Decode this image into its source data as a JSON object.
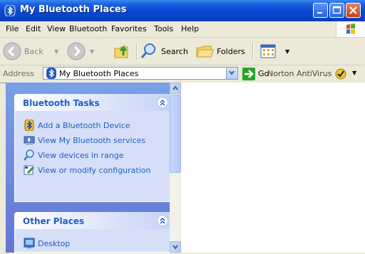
{
  "window": {
    "title": "My Bluetooth Places"
  },
  "menu": {
    "items": [
      "File",
      "Edit",
      "View",
      "Bluetooth",
      "Favorites",
      "Tools",
      "Help"
    ]
  },
  "toolbar": {
    "back": "Back",
    "search": "Search",
    "folders": "Folders"
  },
  "address": {
    "label": "Address",
    "value": "My Bluetooth Places",
    "go": "Go",
    "norton": "Norton AntiVirus"
  },
  "tasks": {
    "bluetooth_title": "Bluetooth Tasks",
    "bluetooth_items": [
      "Add a Bluetooth Device",
      "View My Bluetooth services",
      "View devices in range",
      "View or modify configuration"
    ],
    "other_title": "Other Places",
    "other_items": [
      "Desktop"
    ]
  },
  "colors": {
    "titlebar": "#0a4ad6",
    "task_pane": "#7aa1e6",
    "link": "#215dc6"
  }
}
